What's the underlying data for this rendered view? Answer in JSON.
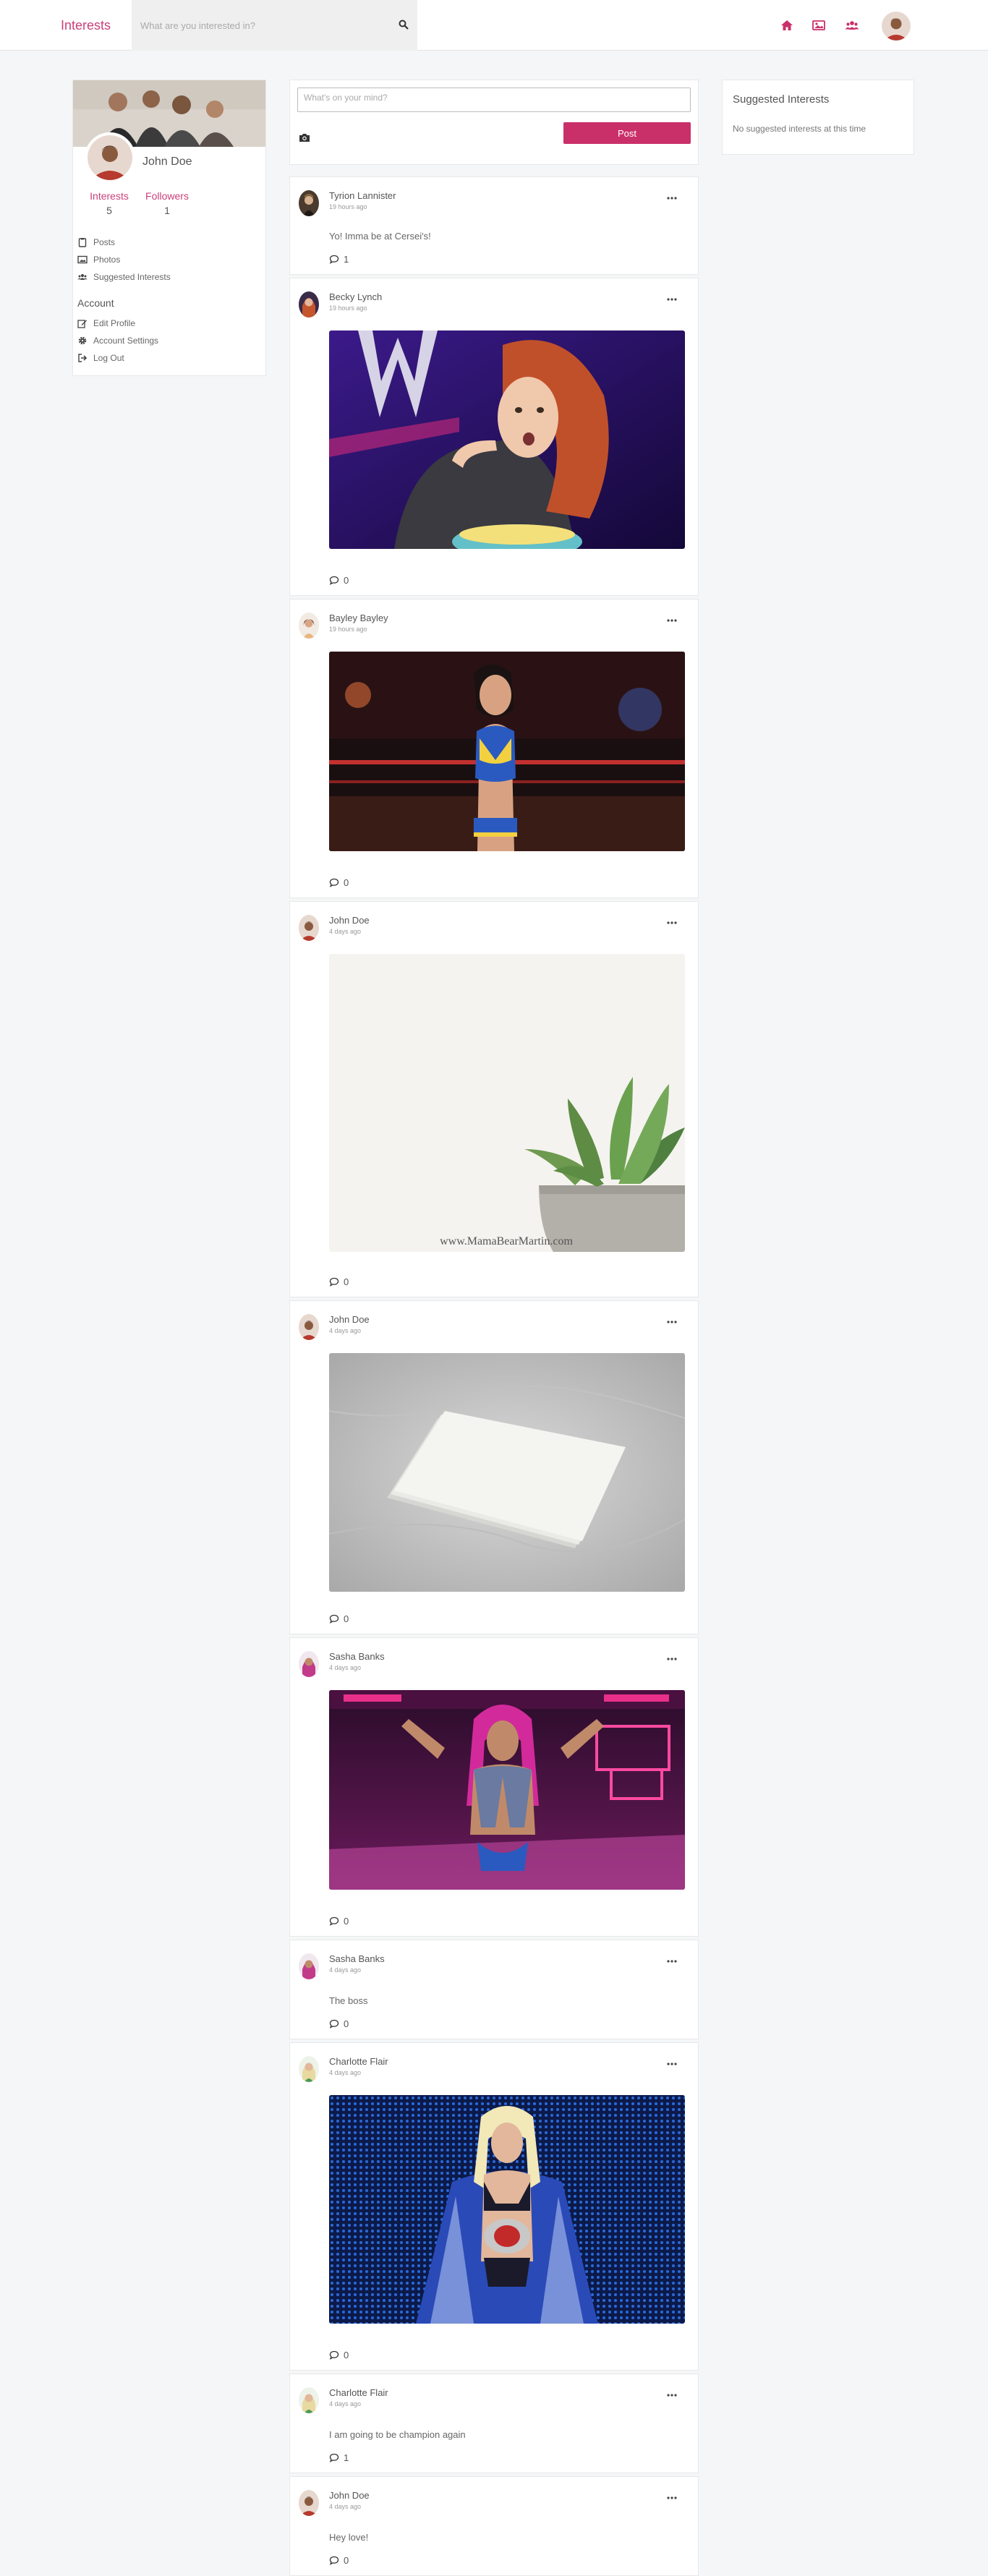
{
  "nav": {
    "brand": "Interests",
    "search_placeholder": "What are you interested in?",
    "icons": [
      "home-icon",
      "image-icon",
      "users-icon"
    ],
    "accent": "#c9306a"
  },
  "profile": {
    "name": "John Doe",
    "interests_label": "Interests",
    "interests_count": "5",
    "followers_label": "Followers",
    "followers_count": "1",
    "menu": [
      "Posts",
      "Photos",
      "Suggested Interests"
    ],
    "account_heading": "Account",
    "account_menu": [
      "Edit Profile",
      "Account Settings",
      "Log Out"
    ]
  },
  "composer": {
    "placeholder": "What's on your mind?",
    "post_label": "Post"
  },
  "suggested": {
    "title": "Suggested Interests",
    "empty_text": "No suggested interests at this time"
  },
  "posts": [
    {
      "author": "Tyrion Lannister",
      "time": "19 hours ago",
      "text": "Yo! Imma be at Cersei's!",
      "comments": "1"
    },
    {
      "author": "Becky Lynch",
      "time": "19 hours ago",
      "comments": "0"
    },
    {
      "author": "Bayley Bayley",
      "time": "19 hours ago",
      "comments": "0"
    },
    {
      "author": "John Doe",
      "time": "4 days ago",
      "watermark": "www.MamaBearMartin.com",
      "comments": "0"
    },
    {
      "author": "John Doe",
      "time": "4 days ago",
      "comments": "0"
    },
    {
      "author": "Sasha Banks",
      "time": "4 days ago",
      "comments": "0"
    },
    {
      "author": "Sasha Banks",
      "time": "4 days ago",
      "text": "The boss",
      "comments": "0"
    },
    {
      "author": "Charlotte Flair",
      "time": "4 days ago",
      "comments": "0"
    },
    {
      "author": "Charlotte Flair",
      "time": "4 days ago",
      "text": "I am going to be champion again",
      "comments": "1"
    },
    {
      "author": "John Doe",
      "time": "4 days ago",
      "text": "Hey love!",
      "comments": "0"
    }
  ]
}
